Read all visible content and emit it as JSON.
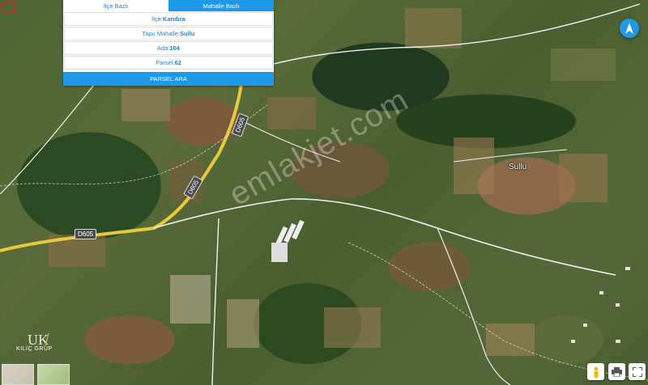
{
  "search_panel": {
    "tabs": [
      {
        "label": "İlçe Bazlı",
        "active": false
      },
      {
        "label": "Mahalle Bazlı",
        "active": true
      }
    ],
    "fields": {
      "ilce_label": "İlçe:",
      "ilce_value": "Kandıra",
      "mahalle_label": "Tapu Mahalle:",
      "mahalle_value": "Sullu",
      "ada_label": "Ada:",
      "ada_value": "104",
      "parsel_label": "Parsel:",
      "parsel_value": "62"
    },
    "search_button": "PARSEL ARA"
  },
  "map": {
    "watermark": "emlakjet.com",
    "road_labels": [
      "D605",
      "D605",
      "D605"
    ],
    "place_label": "Sullu",
    "parcel_color": "#e21b1b"
  },
  "logo": {
    "text": "KILIÇ GRUP"
  },
  "icons": {
    "compass": "compass-north-icon",
    "street_view": "pegman-icon",
    "print": "print-icon",
    "fullscreen": "fullscreen-icon"
  },
  "colors": {
    "accent": "#1e98e8",
    "parcel": "#e21b1b"
  }
}
